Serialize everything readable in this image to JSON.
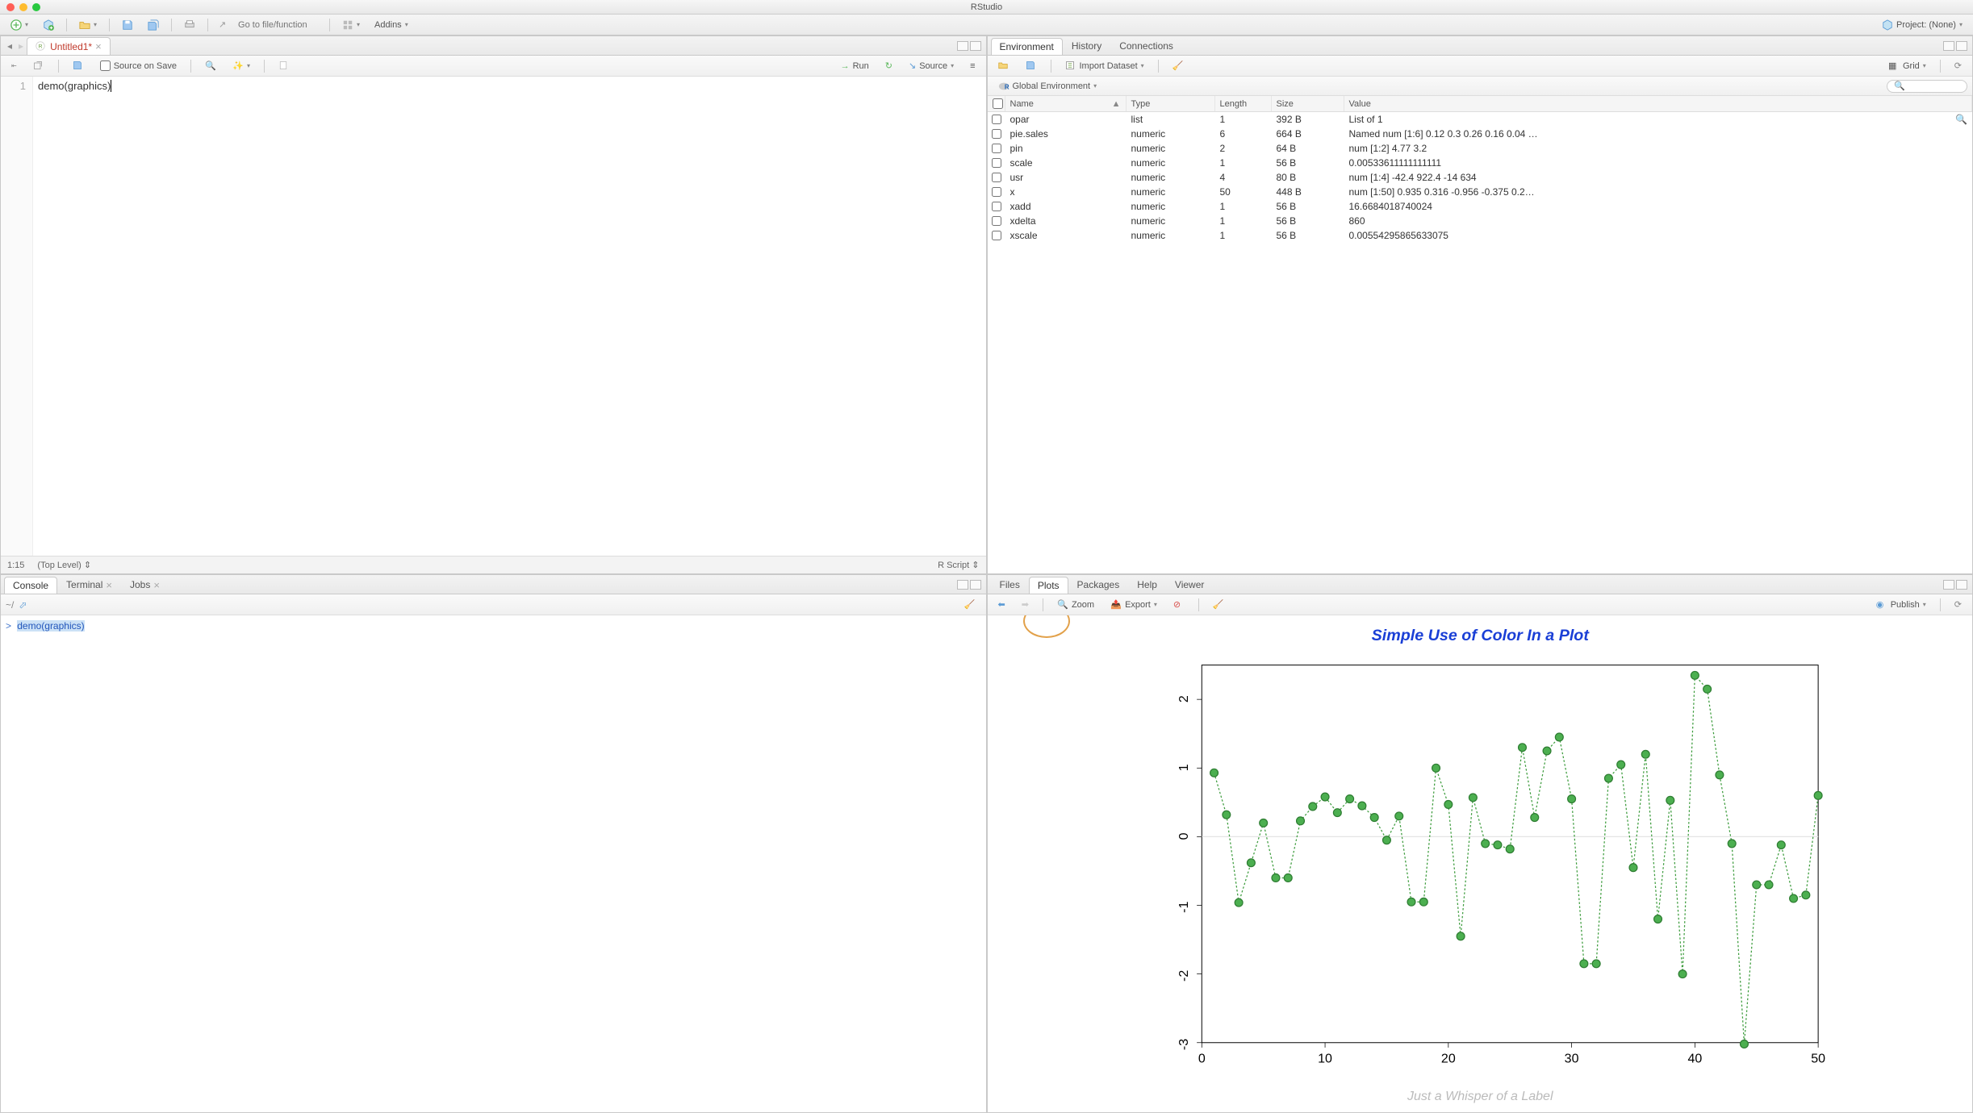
{
  "app": {
    "title": "RStudio"
  },
  "toolbar": {
    "goto_placeholder": "Go to file/function",
    "addins_label": "Addins",
    "project_label": "Project: (None)"
  },
  "editor": {
    "tab_label": "Untitled1*",
    "source_on_save": "Source on Save",
    "run_label": "Run",
    "source_label": "Source",
    "line_no": "1",
    "code_line": "demo(graphics)",
    "cursor_pos": "1:15",
    "scope": "(Top Level)",
    "lang": "R Script"
  },
  "console": {
    "tabs": [
      "Console",
      "Terminal",
      "Jobs"
    ],
    "path": "~/",
    "prompt": ">",
    "last_cmd": "demo(graphics)"
  },
  "env": {
    "tabs": [
      "Environment",
      "History",
      "Connections"
    ],
    "import_label": "Import Dataset",
    "scope": "Global Environment",
    "grid_label": "Grid",
    "cols": [
      "Name",
      "Type",
      "Length",
      "Size",
      "Value"
    ],
    "rows": [
      {
        "name": "opar",
        "type": "list",
        "length": "1",
        "size": "392 B",
        "value": "List of 1"
      },
      {
        "name": "pie.sales",
        "type": "numeric",
        "length": "6",
        "size": "664 B",
        "value": "Named num [1:6] 0.12 0.3 0.26 0.16 0.04 …"
      },
      {
        "name": "pin",
        "type": "numeric",
        "length": "2",
        "size": "64 B",
        "value": "num [1:2] 4.77 3.2"
      },
      {
        "name": "scale",
        "type": "numeric",
        "length": "1",
        "size": "56 B",
        "value": "0.00533611111111111"
      },
      {
        "name": "usr",
        "type": "numeric",
        "length": "4",
        "size": "80 B",
        "value": "num [1:4] -42.4 922.4 -14 634"
      },
      {
        "name": "x",
        "type": "numeric",
        "length": "50",
        "size": "448 B",
        "value": "num [1:50] 0.935 0.316 -0.956 -0.375 0.2…"
      },
      {
        "name": "xadd",
        "type": "numeric",
        "length": "1",
        "size": "56 B",
        "value": "16.6684018740024"
      },
      {
        "name": "xdelta",
        "type": "numeric",
        "length": "1",
        "size": "56 B",
        "value": "860"
      },
      {
        "name": "xscale",
        "type": "numeric",
        "length": "1",
        "size": "56 B",
        "value": "0.00554295865633075"
      }
    ]
  },
  "plots": {
    "tabs": [
      "Files",
      "Plots",
      "Packages",
      "Help",
      "Viewer"
    ],
    "zoom": "Zoom",
    "export": "Export",
    "publish": "Publish"
  },
  "chart_data": {
    "type": "line",
    "title": "Simple Use of Color In a Plot",
    "xlabel": "",
    "ylabel": "",
    "subtitle": "Just a Whisper of a Label",
    "xlim": [
      0,
      50
    ],
    "ylim": [
      -3,
      2.5
    ],
    "xticks": [
      0,
      10,
      20,
      30,
      40,
      50
    ],
    "yticks": [
      -3,
      -2,
      -1,
      0,
      1,
      2
    ],
    "x": [
      1,
      2,
      3,
      4,
      5,
      6,
      7,
      8,
      9,
      10,
      11,
      12,
      13,
      14,
      15,
      16,
      17,
      18,
      19,
      20,
      21,
      22,
      23,
      24,
      25,
      26,
      27,
      28,
      29,
      30,
      31,
      32,
      33,
      34,
      35,
      36,
      37,
      38,
      39,
      40,
      41,
      42,
      43,
      44,
      45,
      46,
      47,
      48,
      49,
      50
    ],
    "y": [
      0.93,
      0.32,
      -0.96,
      -0.38,
      0.2,
      -0.6,
      -0.6,
      0.23,
      0.44,
      0.58,
      0.35,
      0.55,
      0.45,
      0.28,
      -0.05,
      0.3,
      -0.95,
      -0.95,
      1.0,
      0.47,
      -1.45,
      0.57,
      -0.1,
      -0.12,
      -0.18,
      1.3,
      0.28,
      1.25,
      1.45,
      0.55,
      -1.85,
      -1.85,
      0.85,
      1.05,
      -0.45,
      1.2,
      -1.2,
      0.53,
      -2.0,
      2.35,
      2.15,
      0.9,
      -0.1,
      -3.02,
      -0.7,
      -0.7,
      -0.12,
      -0.9,
      -0.85,
      0.6
    ]
  }
}
